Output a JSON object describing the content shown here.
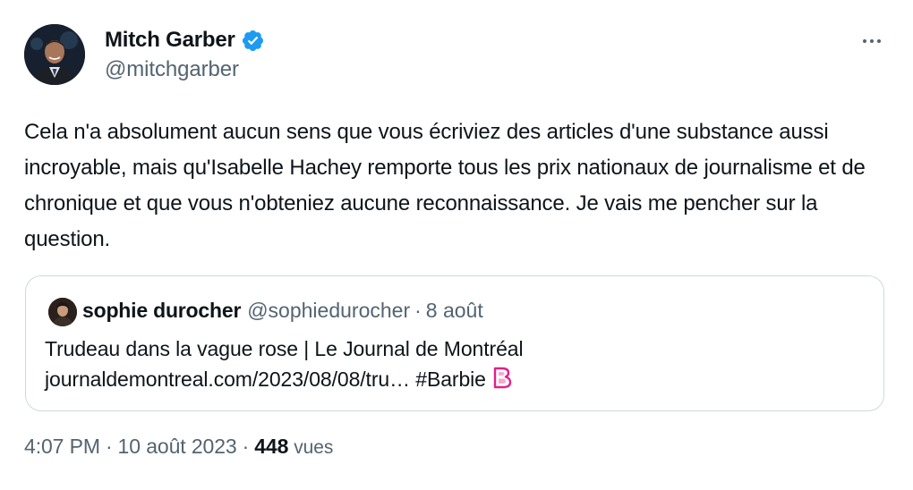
{
  "author": {
    "name": "Mitch Garber",
    "handle": "@mitchgarber",
    "verified": true,
    "verified_color": "#1d9bf0"
  },
  "more_icon": "more-options-icon",
  "tweet_text": "Cela n'a absolument aucun sens que vous écriviez des articles d'une substance aussi incroyable, mais qu'Isabelle Hachey remporte tous les prix nationaux de journalisme et de chronique et que vous n'obteniez aucune reconnaissance. Je vais me pencher sur la question.",
  "quoted": {
    "name": "sophie durocher",
    "handle": "@sophiedurocher",
    "separator": "·",
    "date": "8 août",
    "line1": "Trudeau dans la vague rose | Le Journal de Montréal",
    "link": "journaldemontreal.com/2023/08/08/tru…",
    "hashtag": "#Barbie",
    "emoji": "barbie-logo-icon"
  },
  "meta": {
    "time": "4:07 PM",
    "separator": "·",
    "date": "10 août 2023",
    "views_count": "448",
    "views_label": "vues"
  },
  "colors": {
    "text": "#0f1419",
    "secondary": "#536471",
    "border": "#cfd9de",
    "accent": "#1d9bf0",
    "barbie_pink": "#e0218a"
  }
}
